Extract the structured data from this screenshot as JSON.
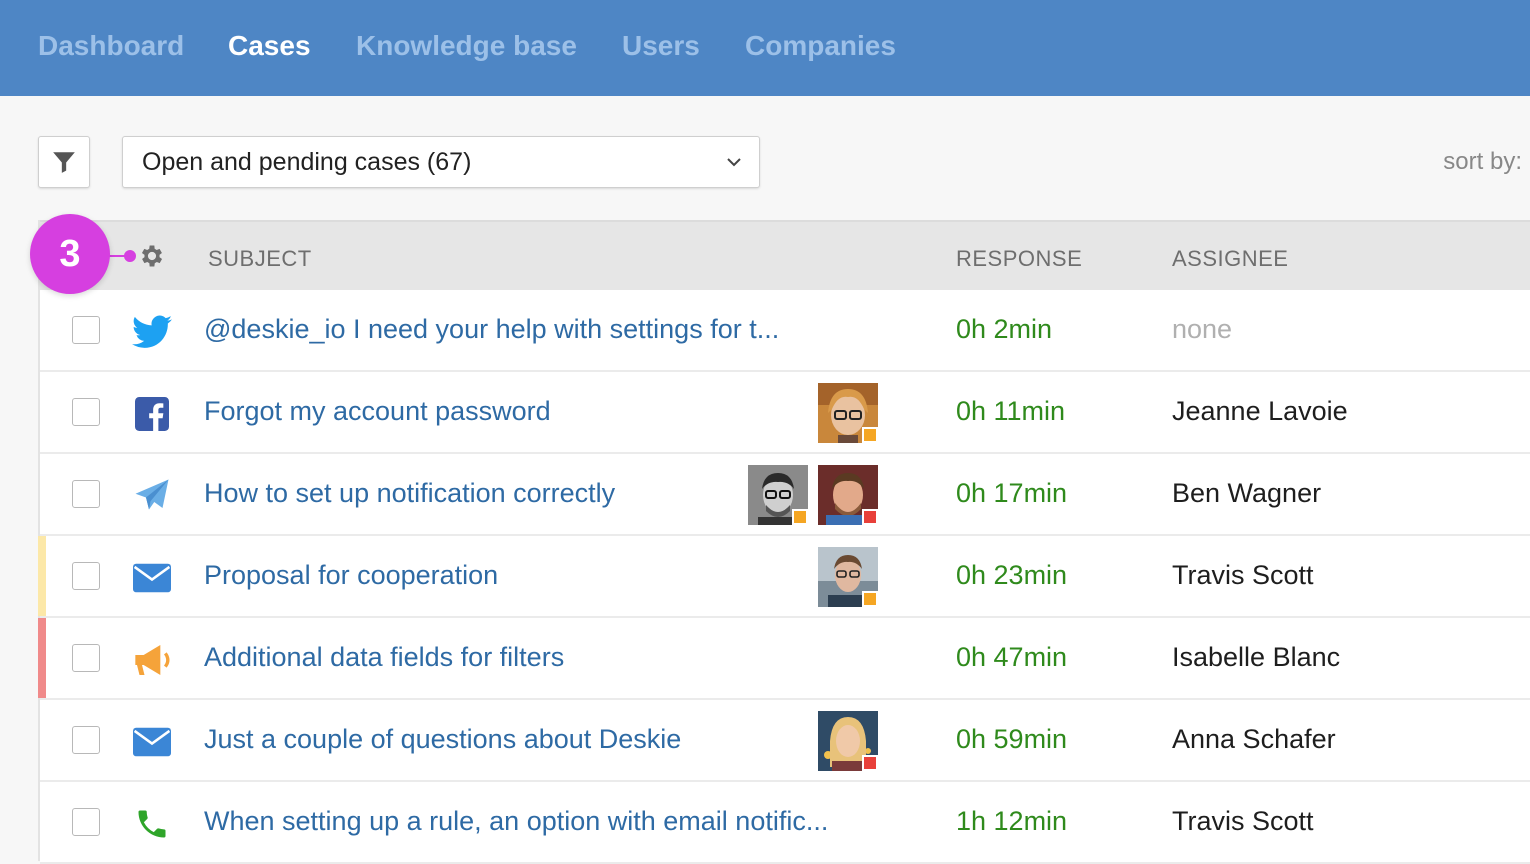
{
  "nav": {
    "items": [
      {
        "label": "Dashboard",
        "active": false
      },
      {
        "label": "Cases",
        "active": true
      },
      {
        "label": "Knowledge base",
        "active": false
      },
      {
        "label": "Users",
        "active": false
      },
      {
        "label": "Companies",
        "active": false
      }
    ]
  },
  "toolbar": {
    "filter_icon": "filter-icon",
    "case_filter_value": "Open and pending cases (67)",
    "sort_label": "sort by:"
  },
  "table": {
    "settings_icon": "gear-icon",
    "columns": {
      "subject": "SUBJECT",
      "response": "RESPONSE",
      "assignee": "ASSIGNEE"
    },
    "rows": [
      {
        "channel": "twitter-icon",
        "subject": "@deskie_io I need your help with settings for t...",
        "response": "0h 2min",
        "assignee": "none",
        "stripe": null,
        "avatars": []
      },
      {
        "channel": "facebook-icon",
        "subject": "Forgot my account password",
        "response": "0h 11min",
        "assignee": "Jeanne Lavoie",
        "stripe": null,
        "avatars": [
          {
            "status_color": "#f5a623"
          }
        ]
      },
      {
        "channel": "paper-plane-icon",
        "subject": "How to set up notification correctly",
        "response": "0h 17min",
        "assignee": "Ben Wagner",
        "stripe": null,
        "avatars": [
          {
            "status_color": "#f5a623"
          },
          {
            "status_color": "#e8403a"
          }
        ]
      },
      {
        "channel": "envelope-icon",
        "subject": "Proposal for cooperation",
        "response": "0h 23min",
        "assignee": "Travis Scott",
        "stripe": "#fce8a8",
        "avatars": [
          {
            "status_color": "#f5a623"
          }
        ]
      },
      {
        "channel": "megaphone-icon",
        "subject": "Additional data fields for filters",
        "response": "0h 47min",
        "assignee": "Isabelle Blanc",
        "stripe": "#f08a8a",
        "avatars": []
      },
      {
        "channel": "envelope-icon",
        "subject": "Just a couple of questions about Deskie",
        "response": "0h 59min",
        "assignee": "Anna Schafer",
        "stripe": null,
        "avatars": [
          {
            "status_color": "#e8403a"
          }
        ]
      },
      {
        "channel": "phone-icon",
        "subject": "When setting up a rule, an option with email notific...",
        "response": "1h 12min",
        "assignee": "Travis Scott",
        "stripe": null,
        "avatars": []
      }
    ]
  },
  "tutorial_badge": {
    "number": "3"
  },
  "colors": {
    "nav_bg": "#4e86c5",
    "link": "#2e6aa4",
    "response": "#2f8a1c",
    "badge": "#d63fe0"
  }
}
